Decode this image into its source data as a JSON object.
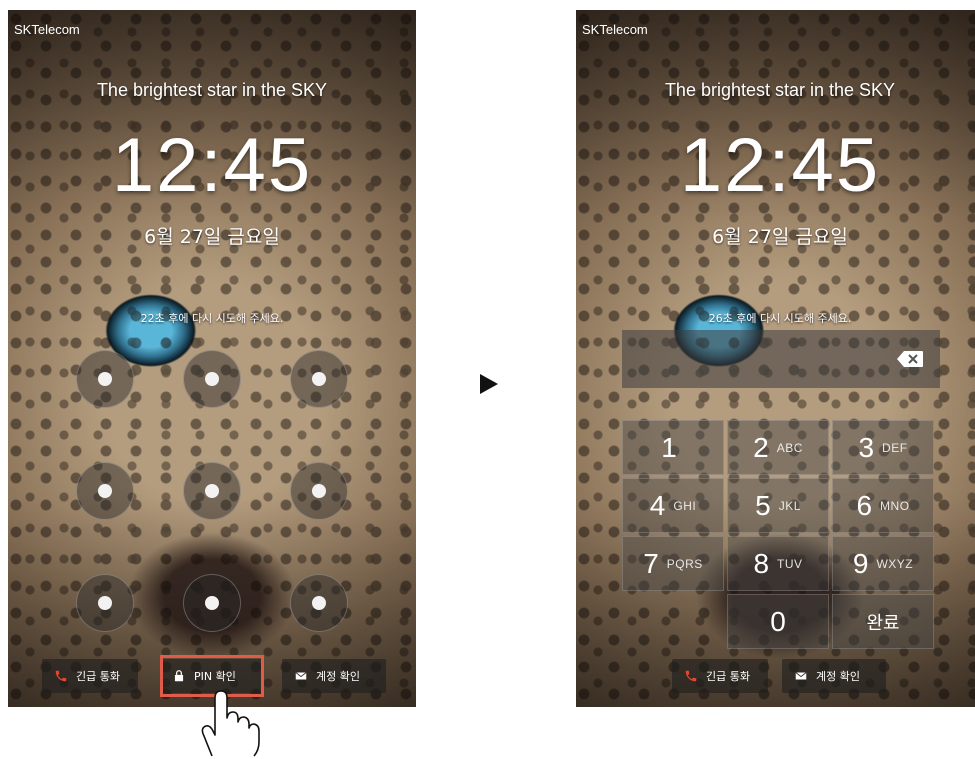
{
  "left_phone": {
    "carrier": "SKTelecom",
    "owner_text": "The brightest star in the SKY",
    "clock": "12:45",
    "date": "6월 27일 금요일",
    "retry_message": "22초 후에 다시 시도해 주세요.",
    "bottom": {
      "emergency_label": "긴급 통화",
      "pin_label": "PIN 확인",
      "account_label": "계정 확인"
    },
    "pattern_dots": 9,
    "highlight_color": "#e15b49"
  },
  "right_phone": {
    "carrier": "SKTelecom",
    "owner_text": "The brightest star in the SKY",
    "clock": "12:45",
    "date": "6월 27일 금요일",
    "retry_message": "26초 후에 다시 시도해 주세요.",
    "keys": [
      {
        "num": "1",
        "sub": ""
      },
      {
        "num": "2",
        "sub": "ABC"
      },
      {
        "num": "3",
        "sub": "DEF"
      },
      {
        "num": "4",
        "sub": "GHI"
      },
      {
        "num": "5",
        "sub": "JKL"
      },
      {
        "num": "6",
        "sub": "MNO"
      },
      {
        "num": "7",
        "sub": "PQRS"
      },
      {
        "num": "8",
        "sub": "TUV"
      },
      {
        "num": "9",
        "sub": "WXYZ"
      },
      {
        "num": "0",
        "sub": ""
      },
      {
        "num": "완료",
        "sub": ""
      }
    ],
    "bottom": {
      "emergency_label": "긴급 통화",
      "account_label": "계정 확인"
    }
  },
  "icons": {
    "emergency": "phone-icon",
    "pin": "lock-icon",
    "account": "envelope-icon",
    "backspace": "backspace-icon",
    "transition": "play-arrow-icon",
    "pointer": "hand-pointer-icon"
  },
  "colors": {
    "emergency_icon": "#e8452f",
    "highlight": "#e15b49"
  }
}
